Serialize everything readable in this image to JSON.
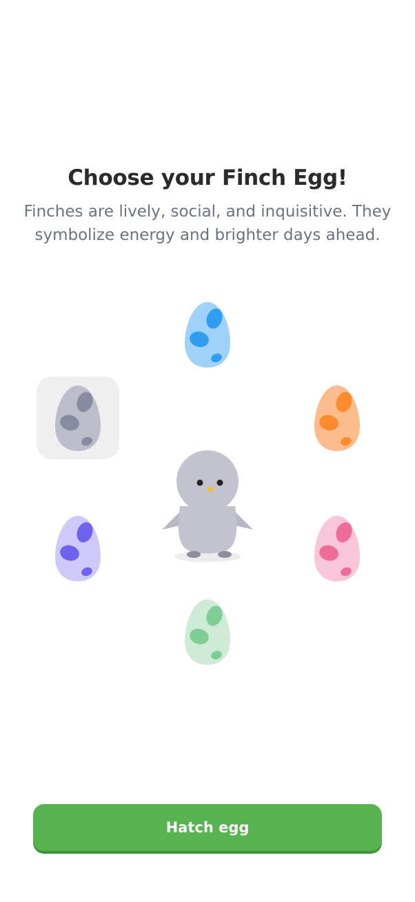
{
  "header": {
    "title": "Choose your Finch Egg!",
    "subtitle": "Finches are lively, social, and inquisitive. They symbolize energy and brighter days ahead."
  },
  "eggs": [
    {
      "name": "blue",
      "shell": "#9fd2fb",
      "spot": "#2f9df0",
      "selected": false
    },
    {
      "name": "orange",
      "shell": "#fcbc8c",
      "spot": "#fb8b2d",
      "selected": false
    },
    {
      "name": "pink",
      "shell": "#f9c5d8",
      "spot": "#ee6c98",
      "selected": false
    },
    {
      "name": "green",
      "shell": "#cdebd5",
      "spot": "#7fce95",
      "selected": false
    },
    {
      "name": "purple",
      "shell": "#cdc9fb",
      "spot": "#6f62ee",
      "selected": false
    },
    {
      "name": "gray",
      "shell": "#bcbdcb",
      "spot": "#878ba0",
      "selected": true
    }
  ],
  "pet": {
    "icon": "penguin-chick-icon"
  },
  "actions": {
    "hatch_label": "Hatch egg"
  },
  "colors": {
    "accent": "#56b34f",
    "selection_bg": "#efeff0"
  }
}
